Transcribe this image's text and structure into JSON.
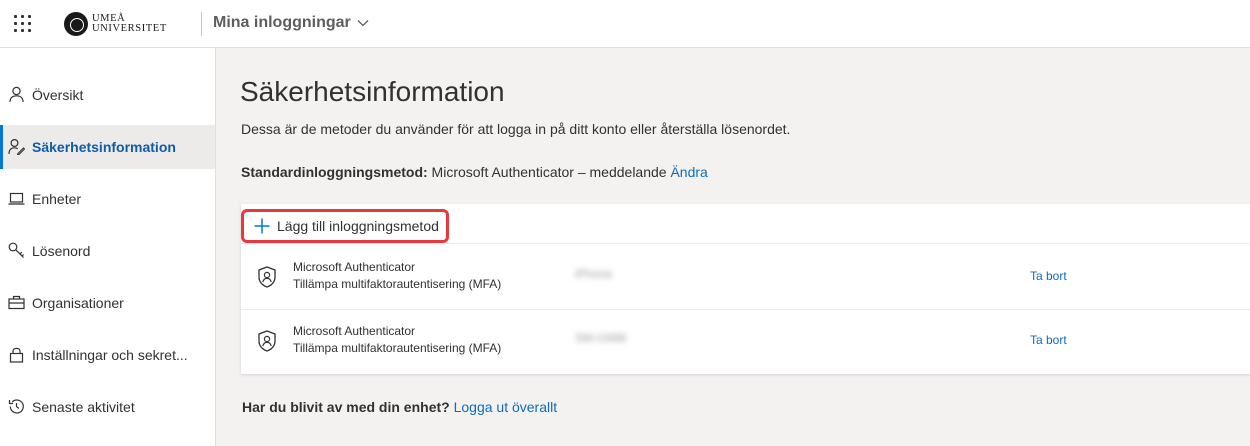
{
  "header": {
    "logo_line1": "UMEÅ",
    "logo_line2": "UNIVERSITET",
    "app_title": "Mina inloggningar"
  },
  "sidebar": {
    "items": [
      {
        "label": "Översikt",
        "icon": "person-icon"
      },
      {
        "label": "Säkerhetsinformation",
        "icon": "security-info-icon",
        "active": true
      },
      {
        "label": "Enheter",
        "icon": "laptop-icon"
      },
      {
        "label": "Lösenord",
        "icon": "key-icon"
      },
      {
        "label": "Organisationer",
        "icon": "briefcase-icon"
      },
      {
        "label": "Inställningar och sekret...",
        "icon": "lock-icon"
      },
      {
        "label": "Senaste aktivitet",
        "icon": "history-icon"
      }
    ]
  },
  "main": {
    "title": "Säkerhetsinformation",
    "description": "Dessa är de metoder du använder för att logga in på ditt konto eller återställa lösenordet.",
    "default_method_label": "Standardinloggningsmetod:",
    "default_method_value": "Microsoft Authenticator – meddelande",
    "default_method_change": "Ändra",
    "add_method_label": "Lägg till inloggningsmetod",
    "methods": [
      {
        "name": "Microsoft Authenticator",
        "subtitle": "Tillämpa multifaktorautentisering (MFA)",
        "detail": "iPhone",
        "remove_label": "Ta bort"
      },
      {
        "name": "Microsoft Authenticator",
        "subtitle": "Tillämpa multifaktorautentisering (MFA)",
        "detail": "SM-G998",
        "remove_label": "Ta bort"
      }
    ],
    "lost_device_question": "Har du blivit av med din enhet?",
    "lost_device_link": "Logga ut överallt"
  },
  "colors": {
    "accent": "#0078d4",
    "link": "#0f6cbd",
    "highlight": "#e8383f",
    "background": "#f3f2f1"
  }
}
